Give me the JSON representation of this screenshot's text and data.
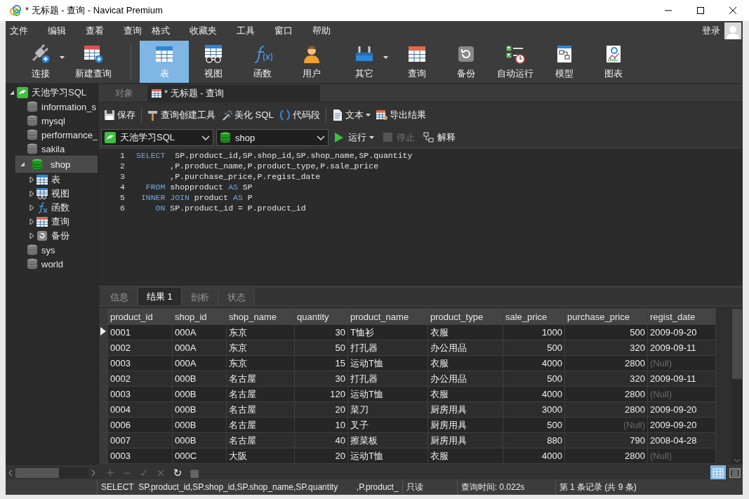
{
  "window": {
    "title": "* 无标题 - 查询 - Navicat Premium"
  },
  "menu": {
    "items": [
      "文件",
      "编辑",
      "查看",
      "查询",
      "格式",
      "收藏夹",
      "工具",
      "窗口",
      "帮助"
    ],
    "login": "登录"
  },
  "toolbar": [
    {
      "kind": "connect",
      "label": "连接",
      "has_menu": true,
      "selected": false
    },
    {
      "kind": "new-query",
      "label": "新建查询",
      "has_menu": false,
      "selected": false
    },
    {
      "kind": "table",
      "label": "表",
      "has_menu": false,
      "selected": true
    },
    {
      "kind": "view",
      "label": "视图",
      "has_menu": false,
      "selected": false
    },
    {
      "kind": "function",
      "label": "函数",
      "has_menu": false,
      "selected": false
    },
    {
      "kind": "user",
      "label": "用户",
      "has_menu": false,
      "selected": false
    },
    {
      "kind": "other",
      "label": "其它",
      "has_menu": true,
      "selected": false
    },
    {
      "kind": "query",
      "label": "查询",
      "has_menu": false,
      "selected": false
    },
    {
      "kind": "backup",
      "label": "备份",
      "has_menu": false,
      "selected": false
    },
    {
      "kind": "automation",
      "label": "自动运行",
      "has_menu": false,
      "selected": false
    },
    {
      "kind": "model",
      "label": "模型",
      "has_menu": false,
      "selected": false
    },
    {
      "kind": "chart",
      "label": "图表",
      "has_menu": false,
      "selected": false
    }
  ],
  "sidebar": {
    "tree": [
      {
        "kind": "connection",
        "label": "天池学习SQL",
        "expanded": true,
        "selected": false,
        "children": [
          {
            "kind": "database",
            "label": "information_s",
            "selected": false
          },
          {
            "kind": "database",
            "label": "mysql",
            "selected": false
          },
          {
            "kind": "database",
            "label": "performance_",
            "selected": false
          },
          {
            "kind": "database",
            "label": "sakila",
            "selected": false
          },
          {
            "kind": "database",
            "label": "shop",
            "expanded": true,
            "selected": true,
            "children": [
              {
                "kind": "table",
                "label": "表",
                "expanded": false,
                "selected": false
              },
              {
                "kind": "view",
                "label": "视图",
                "expanded": false,
                "selected": false
              },
              {
                "kind": "function",
                "label": "函数",
                "expanded": false,
                "selected": false
              },
              {
                "kind": "query",
                "label": "查询",
                "expanded": false,
                "selected": false
              },
              {
                "kind": "backup",
                "label": "备份",
                "expanded": false,
                "selected": false
              }
            ]
          },
          {
            "kind": "database",
            "label": "sys",
            "selected": false
          },
          {
            "kind": "database",
            "label": "world",
            "selected": false
          }
        ]
      }
    ]
  },
  "editor_tabs": [
    {
      "label": "对象",
      "kind": "objects",
      "selected": false
    },
    {
      "label": "* 无标题 - 查询",
      "kind": "query",
      "selected": true
    }
  ],
  "query_toolbar": [
    {
      "kind": "save",
      "label": "保存",
      "has_menu": false
    },
    {
      "kind": "builder",
      "label": "查询创建工具",
      "has_menu": false
    },
    {
      "kind": "beautify",
      "label": "美化 SQL",
      "has_menu": false
    },
    {
      "kind": "snippet",
      "label": "代码段",
      "has_menu": false
    },
    {
      "kind": "text",
      "label": "文本",
      "has_menu": true
    },
    {
      "kind": "export",
      "label": "导出结果",
      "has_menu": false
    }
  ],
  "connection_select": {
    "value": "天池学习SQL"
  },
  "database_select": {
    "value": "shop"
  },
  "run_controls": [
    {
      "kind": "run",
      "label": "运行",
      "has_menu": true,
      "disabled": false
    },
    {
      "kind": "stop",
      "label": "停止",
      "has_menu": false,
      "disabled": true
    },
    {
      "kind": "explain",
      "label": "解释",
      "has_menu": false,
      "disabled": false
    }
  ],
  "editor": {
    "lines": [
      {
        "number": "1",
        "tokens": [
          {
            "kind": "keyword",
            "text": "SELECT"
          },
          {
            "kind": "plain",
            "text": "  SP.product_id,SP.shop_id,SP.shop_name,SP.quantity"
          }
        ]
      },
      {
        "number": "2",
        "tokens": [
          {
            "kind": "plain",
            "text": "       ,P.product_name,P.product_type,P.sale_price"
          }
        ]
      },
      {
        "number": "3",
        "tokens": [
          {
            "kind": "plain",
            "text": "       ,P.purchase_price,P.regist_date"
          }
        ]
      },
      {
        "number": "4",
        "tokens": [
          {
            "kind": "keyword",
            "text": "  FROM"
          },
          {
            "kind": "plain",
            "text": " shopproduct "
          },
          {
            "kind": "keyword",
            "text": "AS"
          },
          {
            "kind": "plain",
            "text": " SP"
          }
        ]
      },
      {
        "number": "5",
        "tokens": [
          {
            "kind": "keyword",
            "text": " INNER JOIN"
          },
          {
            "kind": "plain",
            "text": " product "
          },
          {
            "kind": "keyword",
            "text": "AS"
          },
          {
            "kind": "plain",
            "text": " P"
          }
        ]
      },
      {
        "number": "6",
        "tokens": [
          {
            "kind": "keyword",
            "text": "    ON"
          },
          {
            "kind": "plain",
            "text": " SP.product_id = P.product_id"
          }
        ]
      }
    ]
  },
  "result_tabs": [
    {
      "label": "信息",
      "selected": false
    },
    {
      "label": "结果 1",
      "selected": true
    },
    {
      "label": "剖析",
      "selected": false
    },
    {
      "label": "状态",
      "selected": false
    }
  ],
  "result_grid": {
    "columns": [
      {
        "name": "product_id",
        "numeric": false
      },
      {
        "name": "shop_id",
        "numeric": false
      },
      {
        "name": "shop_name",
        "numeric": false
      },
      {
        "name": "quantity",
        "numeric": true
      },
      {
        "name": "product_name",
        "numeric": false
      },
      {
        "name": "product_type",
        "numeric": false
      },
      {
        "name": "sale_price",
        "numeric": true
      },
      {
        "name": "purchase_price",
        "numeric": true
      },
      {
        "name": "regist_date",
        "numeric": false
      }
    ],
    "rows": [
      {
        "selected": true,
        "cells": [
          "0001",
          "000A",
          "东京",
          "30",
          "T恤衫",
          "衣服",
          "1000",
          "500",
          "2009-09-20"
        ]
      },
      {
        "selected": false,
        "cells": [
          "0002",
          "000A",
          "东京",
          "50",
          "打孔器",
          "办公用品",
          "500",
          "320",
          "2009-09-11"
        ]
      },
      {
        "selected": false,
        "cells": [
          "0003",
          "000A",
          "东京",
          "15",
          "运动T恤",
          "衣服",
          "4000",
          "2800",
          {
            "text": "(Null)",
            "null": true
          }
        ]
      },
      {
        "selected": false,
        "cells": [
          "0002",
          "000B",
          "名古屋",
          "30",
          "打孔器",
          "办公用品",
          "500",
          "320",
          "2009-09-11"
        ]
      },
      {
        "selected": false,
        "cells": [
          "0003",
          "000B",
          "名古屋",
          "120",
          "运动T恤",
          "衣服",
          "4000",
          "2800",
          {
            "text": "(Null)",
            "null": true
          }
        ]
      },
      {
        "selected": false,
        "cells": [
          "0004",
          "000B",
          "名古屋",
          "20",
          "菜刀",
          "厨房用具",
          "3000",
          "2800",
          "2009-09-20"
        ]
      },
      {
        "selected": false,
        "cells": [
          "0006",
          "000B",
          "名古屋",
          "10",
          "叉子",
          "厨房用具",
          "500",
          {
            "text": "(Null)",
            "null": true
          },
          "2009-09-20"
        ]
      },
      {
        "selected": false,
        "cells": [
          "0007",
          "000B",
          "名古屋",
          "40",
          "擦菜板",
          "厨房用具",
          "880",
          "790",
          "2008-04-28"
        ]
      },
      {
        "selected": false,
        "cells": [
          "0003",
          "000C",
          "大阪",
          "20",
          "运动T恤",
          "衣服",
          "4000",
          "2800",
          {
            "text": "(Null)",
            "null": true
          }
        ]
      }
    ]
  },
  "grid_toolbar": [
    {
      "text": "+",
      "disabled": true
    },
    {
      "text": "−",
      "disabled": true
    },
    {
      "text": "✓",
      "disabled": true
    },
    {
      "text": "×",
      "disabled": true
    },
    {
      "text": "↻",
      "disabled": false
    },
    {
      "text": "■",
      "disabled": true
    }
  ],
  "view_toggle": [
    {
      "kind": "grid",
      "selected": true
    },
    {
      "kind": "form",
      "selected": false
    }
  ],
  "status_bar": {
    "sql": "SELECT  SP.product_id,SP.shop_id,SP.shop_name,SP.quantity        ,P.product_",
    "mode": "只读",
    "query_time": "查询时间: 0.022s",
    "record": "第 1 条记录 (共 9 条)"
  }
}
